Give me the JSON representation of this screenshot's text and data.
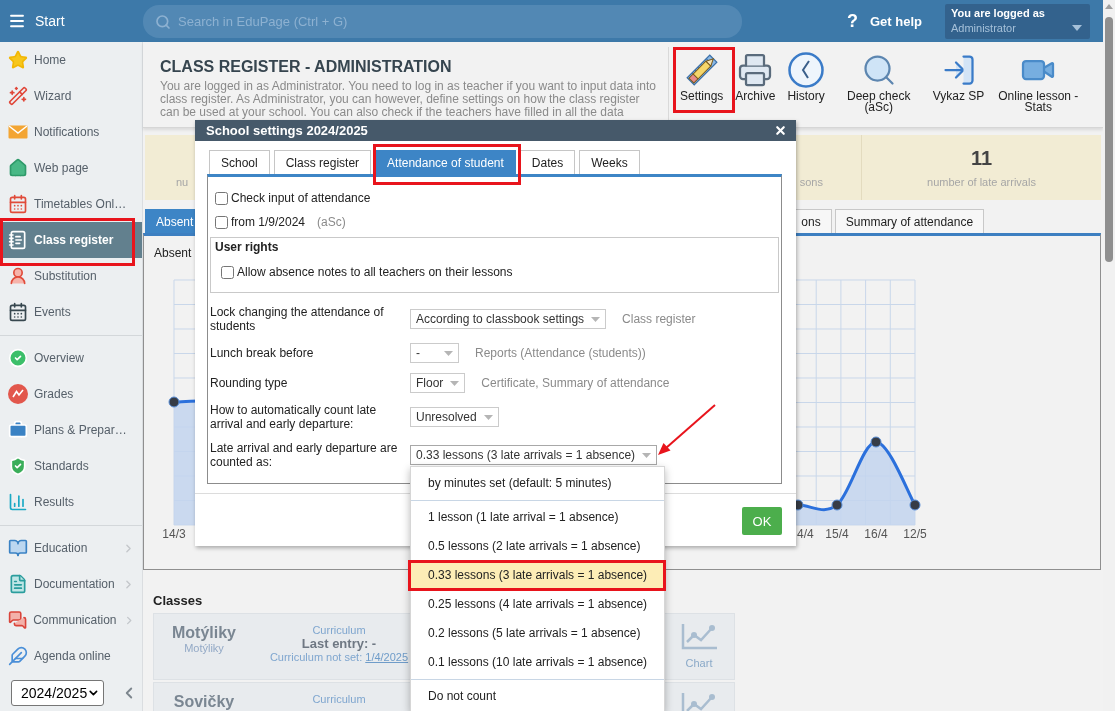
{
  "topbar": {
    "menu_label": "Start",
    "search": {
      "placeholder": "Search in EduPage (Ctrl + G)"
    },
    "help": {
      "icon": "?",
      "label": "Get help"
    },
    "user": {
      "caption": "You are logged as",
      "name": "Administrator"
    }
  },
  "sidebar": {
    "sections": [
      {
        "items": [
          {
            "label": "Home",
            "selected": false,
            "highlighted": false,
            "submenu": false
          },
          {
            "label": "Wizard",
            "selected": false,
            "highlighted": false,
            "submenu": false
          },
          {
            "label": "Notifications",
            "selected": false,
            "highlighted": false,
            "submenu": false
          },
          {
            "label": "Web page",
            "selected": false,
            "highlighted": false,
            "submenu": false
          },
          {
            "label": "Timetables Onl…",
            "selected": false,
            "highlighted": false,
            "submenu": false
          },
          {
            "label": "Class register",
            "selected": true,
            "highlighted": true,
            "submenu": false
          },
          {
            "label": "Substitution",
            "selected": false,
            "highlighted": false,
            "submenu": false
          },
          {
            "label": "Events",
            "selected": false,
            "highlighted": false,
            "submenu": false
          }
        ]
      },
      {
        "items": [
          {
            "label": "Overview",
            "selected": false,
            "highlighted": false,
            "submenu": false
          },
          {
            "label": "Grades",
            "selected": false,
            "highlighted": false,
            "submenu": false
          },
          {
            "label": "Plans & Prepar…",
            "selected": false,
            "highlighted": false,
            "submenu": false
          },
          {
            "label": "Standards",
            "selected": false,
            "highlighted": false,
            "submenu": false
          },
          {
            "label": "Results",
            "selected": false,
            "highlighted": false,
            "submenu": false
          }
        ]
      },
      {
        "items": [
          {
            "label": "Education",
            "selected": false,
            "highlighted": false,
            "submenu": true
          },
          {
            "label": "Documentation",
            "selected": false,
            "highlighted": false,
            "submenu": true
          },
          {
            "label": "Communication",
            "selected": false,
            "highlighted": false,
            "submenu": true
          },
          {
            "label": "Agenda online",
            "selected": false,
            "highlighted": false,
            "submenu": false
          }
        ]
      }
    ],
    "year": "2024/2025"
  },
  "header": {
    "title": "CLASS REGISTER - ADMINISTRATION",
    "description": "You are logged in as Administrator. You need to log in as teacher if you want to input data into class register. As Administrator, you can however, define settings on how the class register can be used at your school. You can also check if the teachers have filled in all the data",
    "toolbar": [
      {
        "label": "Settings",
        "highlighted": true
      },
      {
        "label": "Archive",
        "highlighted": false
      },
      {
        "label": "History",
        "highlighted": false
      },
      {
        "label": "Deep check (aSc)",
        "highlighted": false
      },
      {
        "label": "Vykaz SP",
        "highlighted": false
      },
      {
        "label": "Online lesson - Stats",
        "highlighted": false
      }
    ]
  },
  "stats": [
    {
      "label": "nu"
    },
    {
      "label": "sons"
    },
    {
      "value": "11",
      "label": "number of late arrivals"
    }
  ],
  "tabs": [
    {
      "label": "Absent",
      "selected": true
    },
    {
      "label": "ons",
      "selected": false
    },
    {
      "label": "Summary of attendance",
      "selected": false
    }
  ],
  "chart": {
    "title": "Absent",
    "x_labels": [
      "14/3",
      "4/4",
      "15/4",
      "16/4",
      "12/5"
    ]
  },
  "classes": {
    "title": "Classes",
    "items": [
      {
        "name": "Motýliky",
        "subtitle": "Motýliky",
        "curriculum_label": "Curriculum",
        "last_entry": "Last entry: -",
        "curriculum_note": "Curriculum not set:",
        "curriculum_date": "1/4/2025",
        "chart_label": "Chart"
      },
      {
        "name": "Sovičky",
        "curriculum_label": "Curriculum"
      }
    ]
  },
  "dialog": {
    "title": "School settings 2024/2025",
    "tabs": [
      {
        "label": "School",
        "selected": false,
        "highlighted": false
      },
      {
        "label": "Class register",
        "selected": false,
        "highlighted": false
      },
      {
        "label": "Attendance of student",
        "selected": true,
        "highlighted": true
      },
      {
        "label": "Dates",
        "selected": false,
        "highlighted": false
      },
      {
        "label": "Weeks",
        "selected": false,
        "highlighted": false
      }
    ],
    "checks": [
      {
        "label": "Check input of attendance",
        "checked": false
      },
      {
        "label": "from 1/9/2024",
        "note": "(aSc)",
        "checked": false
      }
    ],
    "user_rights": {
      "title": "User rights",
      "checks": [
        {
          "label": "Allow absence notes to all teachers on their lessons",
          "checked": false
        }
      ]
    },
    "fields": [
      {
        "label": "Lock changing the attendance of students",
        "value": "According to classbook settings",
        "hint": "Class register",
        "expanded": false,
        "annotated": false
      },
      {
        "label": "Lunch break before",
        "value": "-",
        "hint": "Reports (Attendance (students))",
        "expanded": false,
        "annotated": false
      },
      {
        "label": "Rounding type",
        "value": "Floor",
        "hint": "Certificate, Summary of attendance",
        "expanded": false,
        "annotated": false
      },
      {
        "label": "How to automatically count late arrival and early departure:",
        "value": "Unresolved",
        "expanded": false,
        "annotated": false
      },
      {
        "label": "Late arrival and early departure are counted as:",
        "value": "0.33 lessons (3 late arrivals = 1 absence)",
        "expanded": true,
        "annotated": true,
        "option_groups": [
          {
            "options": [
              {
                "label": "by minutes set (default: 5 minutes)",
                "selected": false,
                "highlighted": false
              }
            ]
          },
          {
            "options": [
              {
                "label": "1 lesson (1 late arrival = 1 absence)",
                "selected": false,
                "highlighted": false
              },
              {
                "label": "0.5 lessons (2 late arrivals = 1 absence)",
                "selected": false,
                "highlighted": false
              },
              {
                "label": "0.33 lessons (3 late arrivals = 1 absence)",
                "selected": true,
                "highlighted": true
              },
              {
                "label": "0.25 lessons (4 late arrivals = 1 absence)",
                "selected": false,
                "highlighted": false
              },
              {
                "label": "0.2 lessons (5 late arrivals = 1 absence)",
                "selected": false,
                "highlighted": false
              },
              {
                "label": "0.1 lessons (10 late arrivals = 1 absence)",
                "selected": false,
                "highlighted": false
              }
            ]
          },
          {
            "options": [
              {
                "label": "Do not count",
                "selected": false,
                "highlighted": false
              }
            ]
          }
        ]
      }
    ],
    "ok_label": "OK"
  }
}
